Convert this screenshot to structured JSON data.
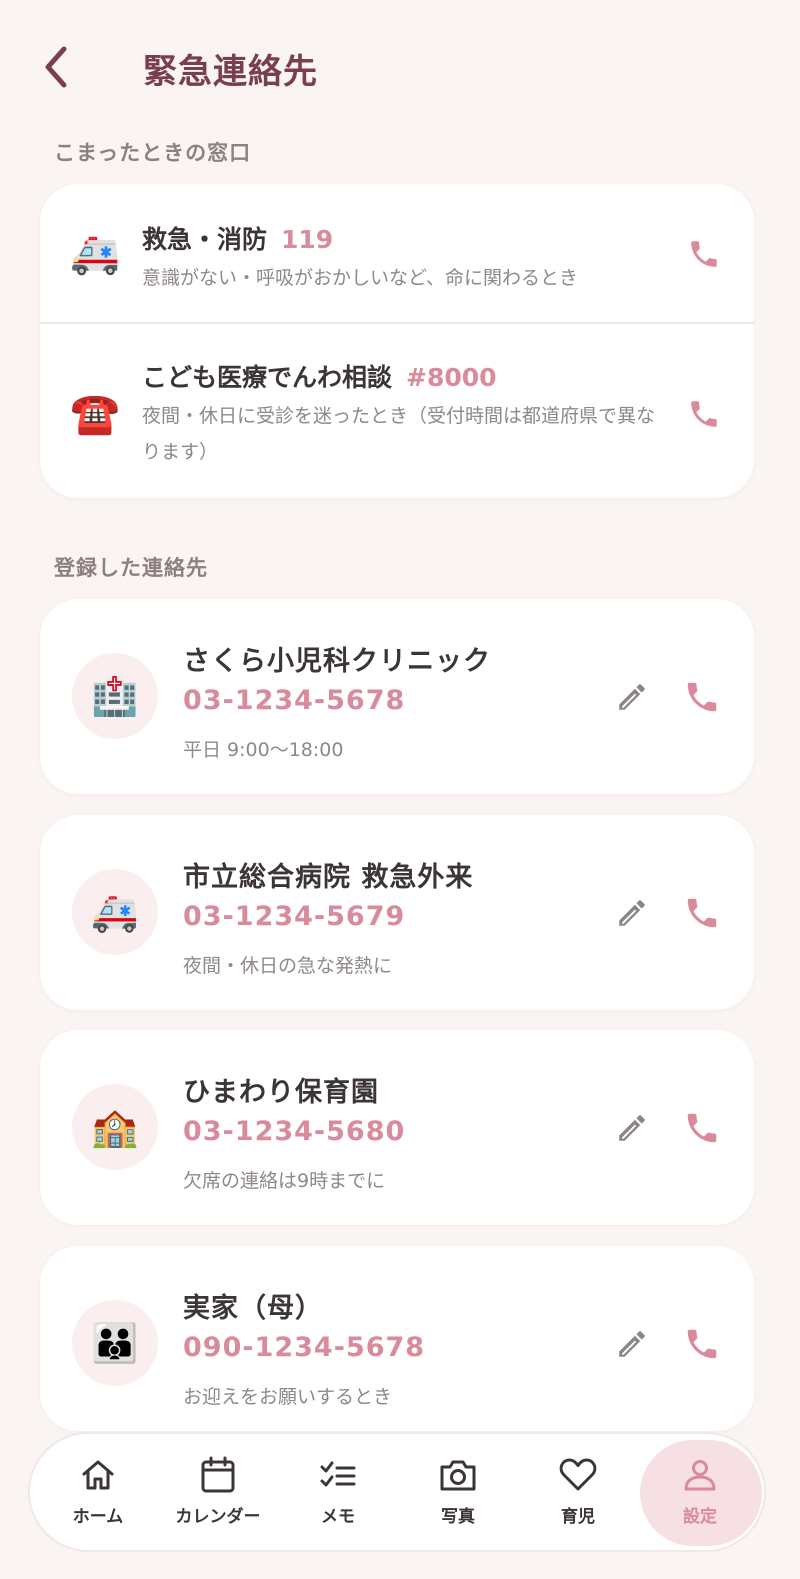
{
  "header": {
    "title": "緊急連絡先"
  },
  "sections": {
    "hotlines_label": "こまったときの窓口",
    "contacts_label": "登録した連絡先"
  },
  "hotlines": [
    {
      "emoji": "🚑",
      "title": "救急・消防",
      "number": "119",
      "desc": "意識がない・呼吸がおかしいなど、命に関わるとき"
    },
    {
      "emoji": "☎️",
      "title": "こども医療でんわ相談",
      "number": "#8000",
      "desc": "夜間・休日に受診を迷ったとき（受付時間は都道府県で異なります）"
    }
  ],
  "contacts": [
    {
      "emoji": "🏥",
      "name": "さくら小児科クリニック",
      "phone": "03-1234-5678",
      "note": "平日 9:00〜18:00"
    },
    {
      "emoji": "🚑",
      "name": "市立総合病院 救急外来",
      "phone": "03-1234-5679",
      "note": "夜間・休日の急な発熱に"
    },
    {
      "emoji": "🏫",
      "name": "ひまわり保育園",
      "phone": "03-1234-5680",
      "note": "欠席の連絡は9時までに"
    },
    {
      "emoji": "👪",
      "name": "実家（母）",
      "phone": "090-1234-5678",
      "note": "お迎えをお願いするとき"
    }
  ],
  "nav": [
    {
      "label": "ホーム",
      "icon": "home-icon"
    },
    {
      "label": "カレンダー",
      "icon": "calendar-icon"
    },
    {
      "label": "メモ",
      "icon": "checklist-icon"
    },
    {
      "label": "写真",
      "icon": "camera-icon"
    },
    {
      "label": "育児",
      "icon": "heart-icon"
    },
    {
      "label": "設定",
      "icon": "person-icon",
      "active": true
    }
  ],
  "colors": {
    "accent": "#d98a9b",
    "title": "#7a3f4c",
    "background": "#faf5f2",
    "card": "#ffffff",
    "avatar_bg": "#fbeeee"
  }
}
